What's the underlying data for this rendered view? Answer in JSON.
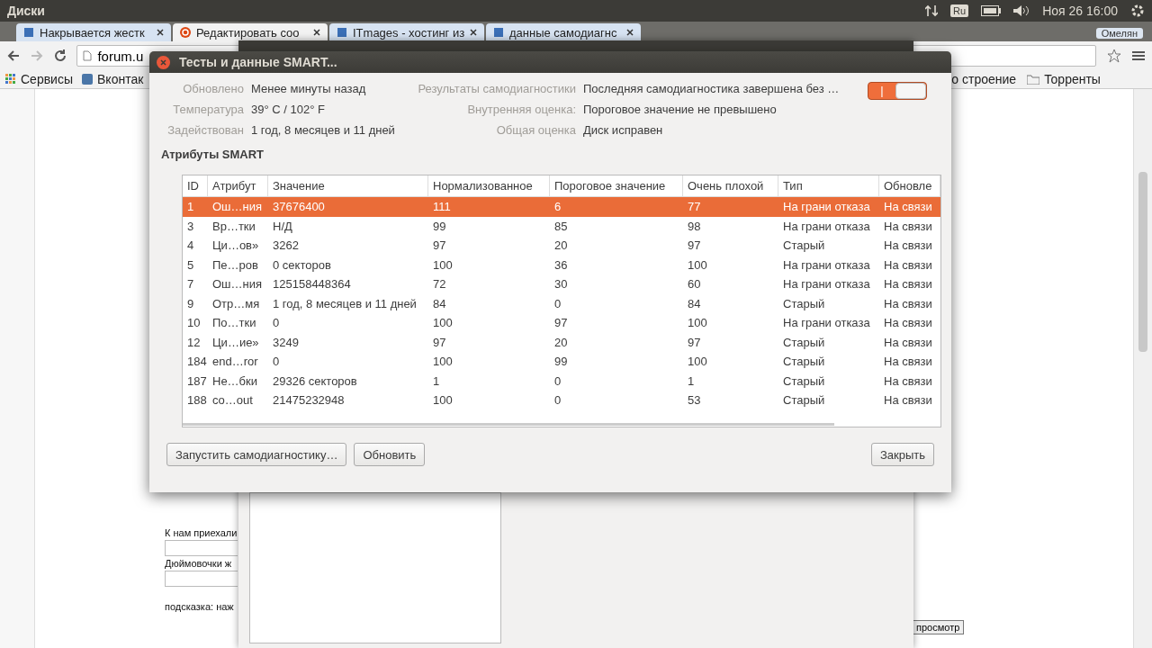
{
  "top_panel": {
    "app_title": "Диски",
    "keyboard_layout": "Ru",
    "clock": "Ноя 26 16:00"
  },
  "browser": {
    "tabs": [
      {
        "title": "Накрывается жестк",
        "selected": false
      },
      {
        "title": "Редактировать coo",
        "selected": true
      },
      {
        "title": "ITmages - хостинг из",
        "selected": false
      },
      {
        "title": "данные самодиагнс",
        "selected": false
      }
    ],
    "profile": "Омелян",
    "address": "forum.u",
    "bookmarks": [
      {
        "label": "Сервисы",
        "kind": "apps"
      },
      {
        "label": "Вконтак",
        "kind": "page"
      },
      {
        "label": "о строение",
        "kind": "plain"
      },
      {
        "label": "Торренты",
        "kind": "folder"
      }
    ]
  },
  "page": {
    "fields": [
      {
        "label": "К нам приехали"
      },
      {
        "label": "Дюймовочки ж"
      }
    ],
    "hint": "подсказка: наж",
    "preview_button": "просмотр"
  },
  "dialog": {
    "title": "Тесты и данные SMART...",
    "info_left": [
      {
        "label": "Обновлено",
        "value": "Менее минуты назад"
      },
      {
        "label": "Температура",
        "value": "39° C / 102° F"
      },
      {
        "label": "Задействован",
        "value": "1 год, 8 месяцев и 11 дней"
      }
    ],
    "info_right": [
      {
        "label": "Результаты самодиагностики",
        "value": "Последняя самодиагностика завершена без …"
      },
      {
        "label": "Внутренняя оценка:",
        "value": "Пороговое значение не превышено"
      },
      {
        "label": "Общая оценка",
        "value": "Диск исправен"
      }
    ],
    "smart_switch": {
      "on": true,
      "glyph": "|"
    },
    "section_title": "Атрибуты SMART",
    "table": {
      "columns": [
        "ID",
        "Атрибут",
        "Значение",
        "Нормализованное",
        "Пороговое значение",
        "Очень плохой",
        "Тип",
        "Обновле"
      ],
      "rows": [
        {
          "selected": true,
          "cells": [
            "1",
            "Ош…ния",
            "37676400",
            "111",
            "6",
            "77",
            "На грани отказа",
            "На связи"
          ]
        },
        {
          "selected": false,
          "cells": [
            "3",
            "Вр…тки",
            "Н/Д",
            "99",
            "85",
            "98",
            "На грани отказа",
            "На связи"
          ]
        },
        {
          "selected": false,
          "cells": [
            "4",
            "Ци…ов»",
            "3262",
            "97",
            "20",
            "97",
            "Старый",
            "На связи"
          ]
        },
        {
          "selected": false,
          "cells": [
            "5",
            "Пе…ров",
            "0 секторов",
            "100",
            "36",
            "100",
            "На грани отказа",
            "На связи"
          ]
        },
        {
          "selected": false,
          "cells": [
            "7",
            "Ош…ния",
            "125158448364",
            "72",
            "30",
            "60",
            "На грани отказа",
            "На связи"
          ]
        },
        {
          "selected": false,
          "cells": [
            "9",
            "Отр…мя",
            "1 год, 8 месяцев и 11 дней",
            "84",
            "0",
            "84",
            "Старый",
            "На связи"
          ]
        },
        {
          "selected": false,
          "cells": [
            "10",
            "По…тки",
            "0",
            "100",
            "97",
            "100",
            "На грани отказа",
            "На связи"
          ]
        },
        {
          "selected": false,
          "cells": [
            "12",
            "Ци…ие»",
            "3249",
            "97",
            "20",
            "97",
            "Старый",
            "На связи"
          ]
        },
        {
          "selected": false,
          "cells": [
            "184",
            "end…ror",
            "0",
            "100",
            "99",
            "100",
            "Старый",
            "На связи"
          ]
        },
        {
          "selected": false,
          "cells": [
            "187",
            "Не…бки",
            "29326 секторов",
            "1",
            "0",
            "1",
            "Старый",
            "На связи"
          ]
        },
        {
          "selected": false,
          "cells": [
            "188",
            "co…out",
            "21475232948",
            "100",
            "0",
            "53",
            "Старый",
            "На связи"
          ]
        }
      ]
    },
    "buttons": [
      {
        "label": "Запустить самодиагностику…",
        "kind": "left"
      },
      {
        "label": "Обновить",
        "kind": "left"
      },
      {
        "label": "Закрыть",
        "kind": "right"
      }
    ]
  }
}
